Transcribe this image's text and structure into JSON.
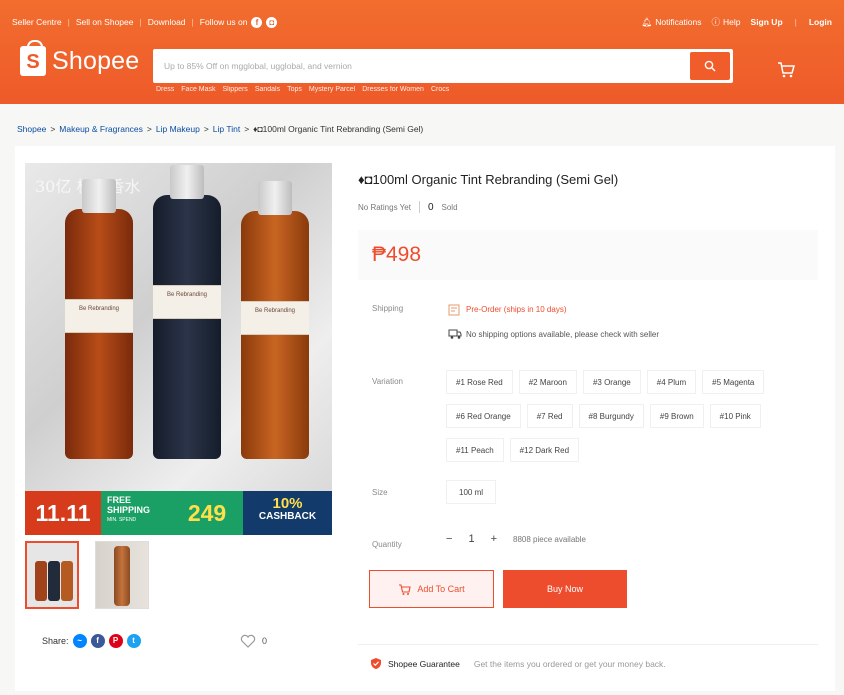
{
  "topbar": {
    "seller_centre": "Seller Centre",
    "sell_on_shopee": "Sell on Shopee",
    "download": "Download",
    "follow_us": "Follow us on",
    "notifications": "Notifications",
    "help": "Help",
    "sign_up": "Sign Up",
    "login": "Login"
  },
  "header": {
    "logo_text": "Shopee",
    "search_placeholder": "Up to 85% Off on mgglobal, ugglobal, and vernion",
    "suggestions": [
      "Dress",
      "Face Mask",
      "Slippers",
      "Sandals",
      "Tops",
      "Mystery Parcel",
      "Dresses for Women",
      "Crocs"
    ]
  },
  "breadcrumb": {
    "items": [
      "Shopee",
      "Makeup & Fragrances",
      "Lip Makeup",
      "Lip Tint"
    ],
    "current": "♦◘100ml Organic Tint Rebranding (Semi Gel)"
  },
  "gallery": {
    "watermark": "30亿 极和香水",
    "bottle_label": "Be Rebranding",
    "promo": {
      "date": "11.11",
      "free_shipping": "FREE SHIPPING",
      "min_spend": "MIN. SPEND",
      "amount": "249",
      "cashback_pct": "10%",
      "cashback": "CASHBACK"
    }
  },
  "share": {
    "label": "Share:"
  },
  "like": {
    "count": "0"
  },
  "product": {
    "title": "♦◘100ml Organic Tint Rebranding (Semi Gel)",
    "ratings_text": "No Ratings Yet",
    "sold_count": "0",
    "sold_label": "Sold",
    "price": "₱498"
  },
  "shipping": {
    "label": "Shipping",
    "preorder": "Pre-Order (ships in 10 days)",
    "no_options": "No shipping options available, please check with seller"
  },
  "variation": {
    "label": "Variation",
    "options": [
      "#1 Rose Red",
      "#2 Maroon",
      "#3 Orange",
      "#4 Plum",
      "#5 Magenta",
      "#6 Red Orange",
      "#7 Red",
      "#8 Burgundy",
      "#9 Brown",
      "#10 Pink",
      "#11 Peach",
      "#12 Dark Red"
    ]
  },
  "size": {
    "label": "Size",
    "option": "100 ml"
  },
  "quantity": {
    "label": "Quantity",
    "minus": "−",
    "value": "1",
    "plus": "+",
    "available": "8808 piece available"
  },
  "actions": {
    "add_to_cart": "Add To Cart",
    "buy_now": "Buy Now"
  },
  "guarantee": {
    "title": "Shopee Guarantee",
    "text": "Get the items you ordered or get your money back."
  },
  "colors": {
    "brand": "#ee4d2d",
    "header": "#f05f2b"
  }
}
